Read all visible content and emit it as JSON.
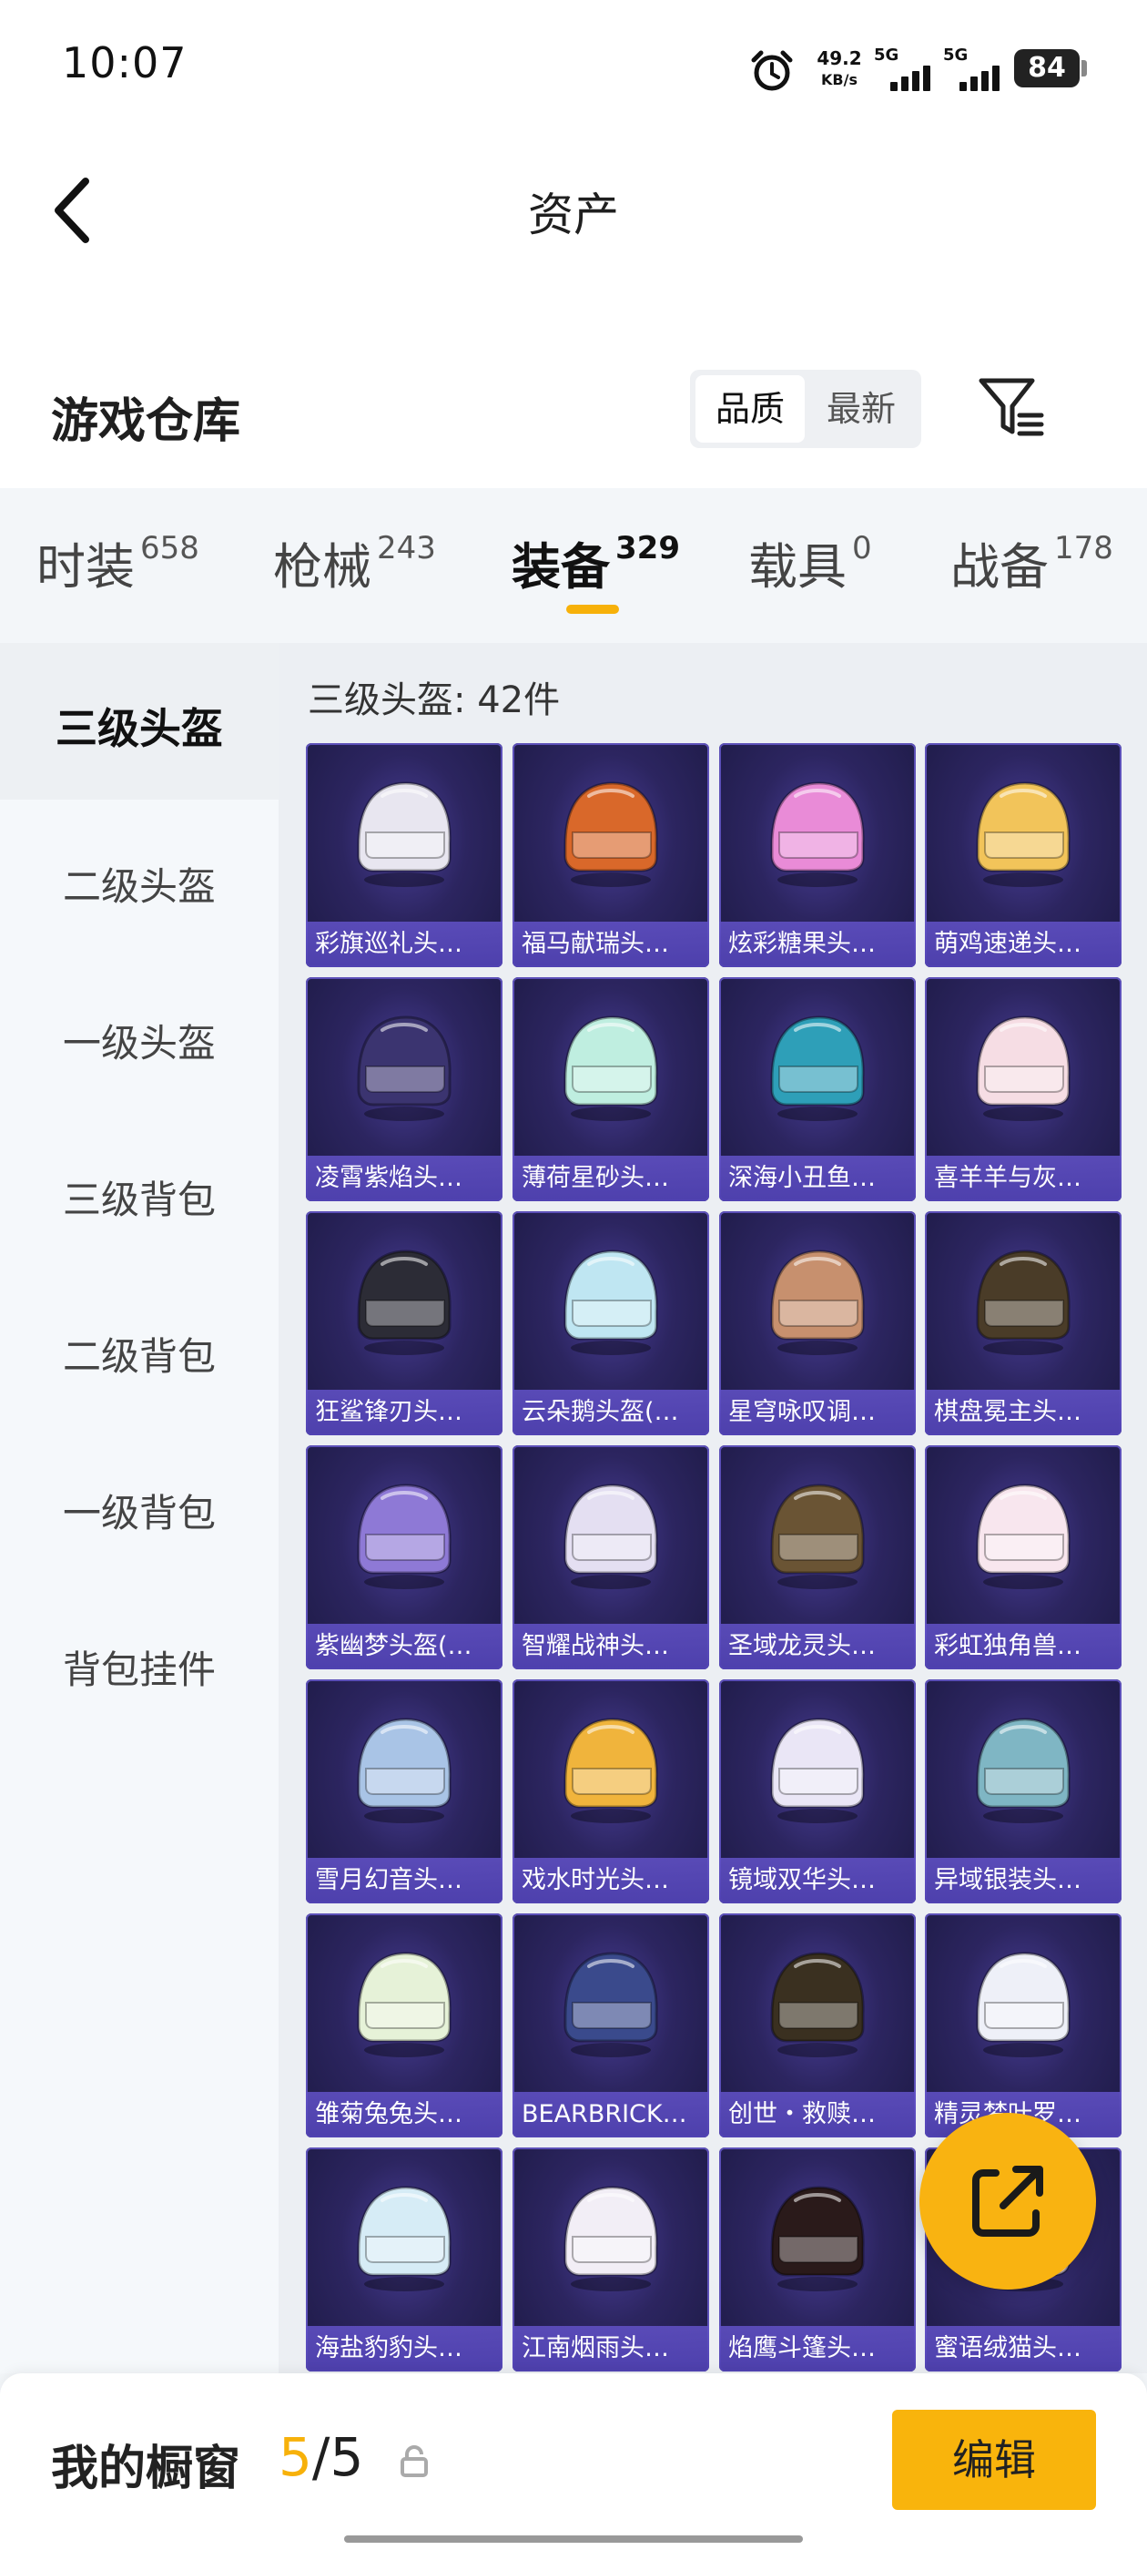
{
  "status_bar": {
    "time": "10:07",
    "net_speed_value": "49.2",
    "net_speed_unit": "KB/s",
    "signal_1_label": "5G",
    "signal_2_label": "5G",
    "battery": "84"
  },
  "header": {
    "title": "资产",
    "back_icon": "chevron-left-icon"
  },
  "section": {
    "title": "游戏仓库",
    "sort_options": [
      "品质",
      "最新"
    ],
    "selected_sort": "品质",
    "filter_icon": "filter-icon"
  },
  "tabs": [
    {
      "label": "时装",
      "count": "658"
    },
    {
      "label": "枪械",
      "count": "243"
    },
    {
      "label": "装备",
      "count": "329"
    },
    {
      "label": "载具",
      "count": "0"
    },
    {
      "label": "战备",
      "count": "178"
    }
  ],
  "active_tab": "装备",
  "sidebar": {
    "items": [
      "三级头盔",
      "二级头盔",
      "一级头盔",
      "三级背包",
      "二级背包",
      "一级背包",
      "背包挂件"
    ],
    "active": "三级头盔"
  },
  "grid": {
    "count_label": "三级头盔: 42件",
    "items": [
      "彩旗巡礼头…",
      "福马献瑞头…",
      "炫彩糖果头…",
      "萌鸡速递头…",
      "凌霄紫焰头…",
      "薄荷星砂头…",
      "深海小丑鱼…",
      "喜羊羊与灰…",
      "狂鲨锋刃头…",
      "云朵鹅头盔(…",
      "星穹咏叹调…",
      "棋盘冕主头…",
      "紫幽梦头盔(…",
      "智耀战神头…",
      "圣域龙灵头…",
      "彩虹独角兽…",
      "雪月幻音头…",
      "戏水时光头…",
      "镜域双华头…",
      "异域银装头…",
      "雏菊兔兔头…",
      "BEARBRICK…",
      "创世・救赎…",
      "精灵梦叶罗…",
      "海盐豹豹头…",
      "江南烟雨头…",
      "焰鹰斗篷头…",
      "蜜语绒猫头…"
    ],
    "helmet_colors": [
      "#e8e6f0",
      "#d9682a",
      "#e98bd7",
      "#f2c45a",
      "#3b3470",
      "#bfeee0",
      "#2e9fb8",
      "#f6dde4",
      "#2c2c36",
      "#bfe6f2",
      "#c7906e",
      "#4a3c28",
      "#8e79d6",
      "#e4dff2",
      "#6a5434",
      "#f8e6ee",
      "#a9c4e6",
      "#f0b43c",
      "#eae6f6",
      "#7fb6c4",
      "#e6f2d8",
      "#3a4a8c",
      "#3a3020",
      "#eef0f8",
      "#d6ecf6",
      "#f2eef6",
      "#2a1a1a",
      "#e6d8f0"
    ]
  },
  "share_icon": "external-link-icon",
  "bottom_bar": {
    "label": "我的橱窗",
    "current": "5",
    "separator": "/",
    "total": "5",
    "lock_icon": "lock-icon",
    "edit_label": "编辑"
  },
  "colors": {
    "accent": "#f7b10a",
    "tile_bg": "#2c2560",
    "tile_label_bg": "#5c4ec0"
  }
}
